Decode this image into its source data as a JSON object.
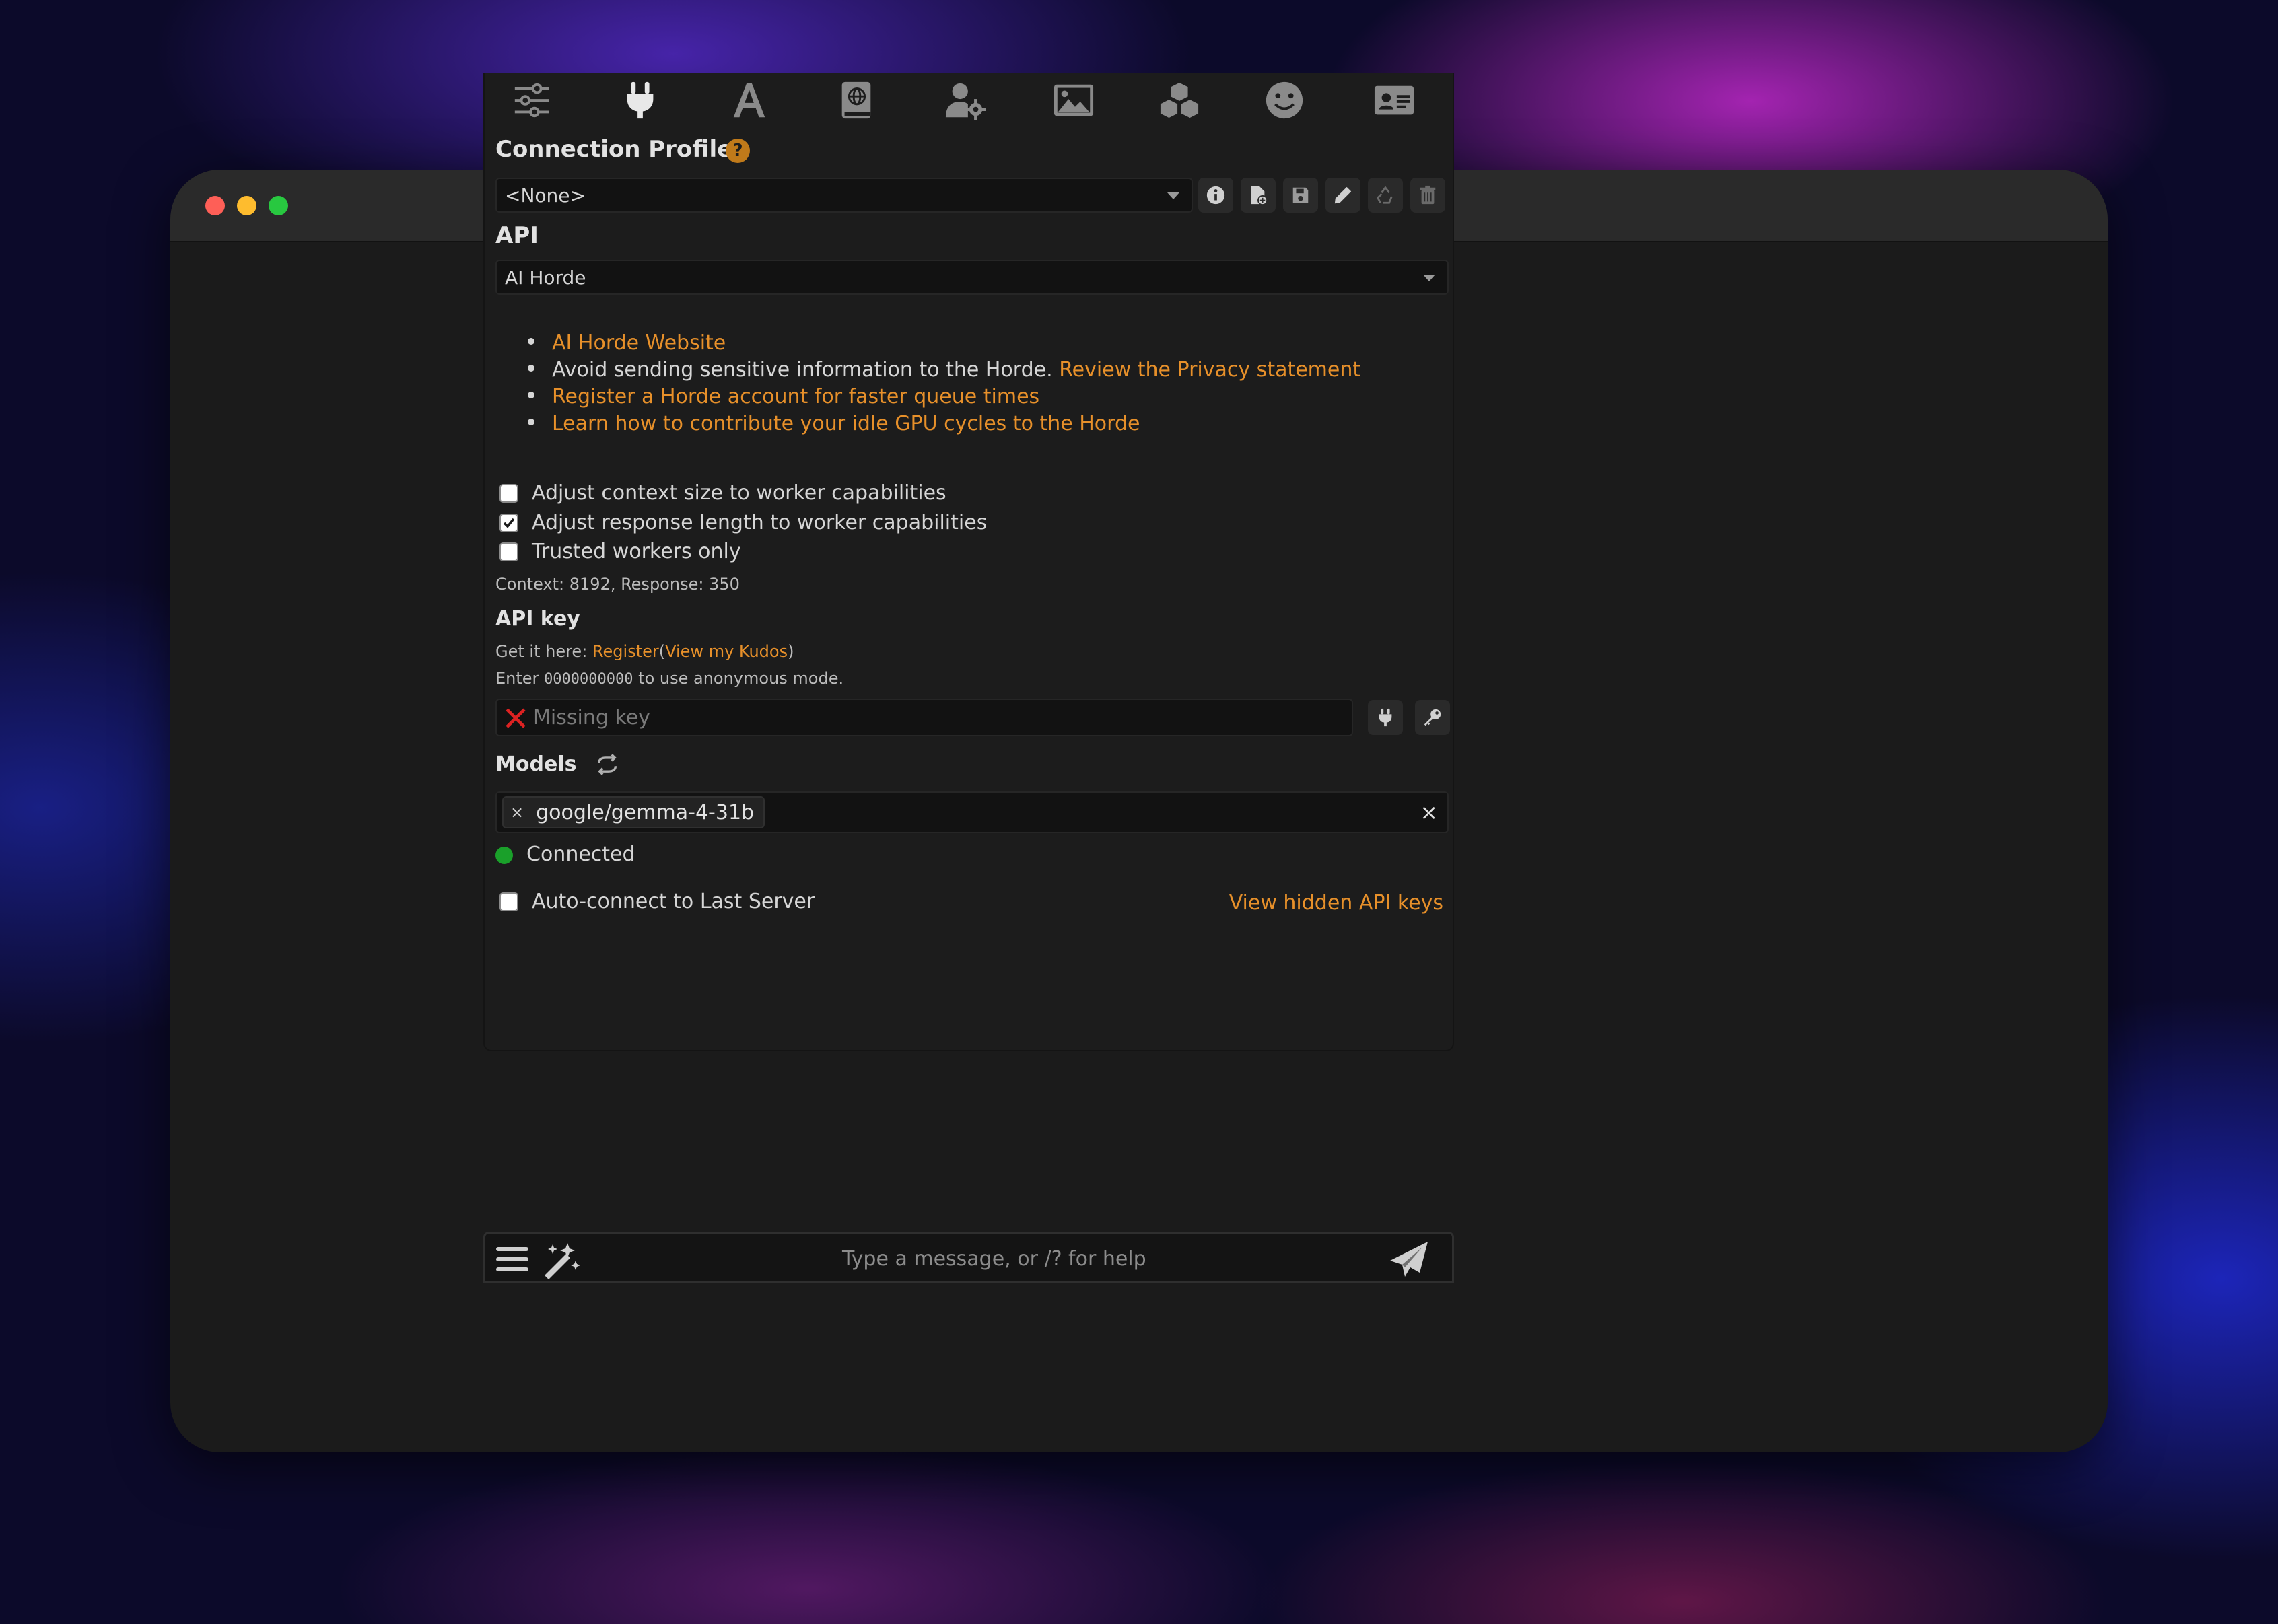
{
  "window": {
    "traffic_lights": [
      "close",
      "minimize",
      "zoom"
    ]
  },
  "topbar": {
    "icons": [
      "sliders-icon",
      "plug-icon",
      "font-icon",
      "book-icon",
      "user-gear-icon",
      "image-icon",
      "cubes-icon",
      "smile-icon",
      "id-card-icon"
    ],
    "active": "plug-icon"
  },
  "connection_profile": {
    "title": "Connection Profile",
    "help": "?",
    "selected": "<None>",
    "buttons": [
      "info-icon",
      "file-plus-icon",
      "save-icon",
      "pencil-icon",
      "recycle-icon",
      "trash-icon"
    ]
  },
  "api": {
    "title": "API",
    "selected": "AI Horde"
  },
  "info_list": {
    "item1_link": "AI Horde Website",
    "item2_text": "Avoid sending sensitive information to the Horde.",
    "item2_link": "Review the Privacy statement",
    "item3_link": "Register a Horde account for faster queue times",
    "item4_link": "Learn how to contribute your idle GPU cycles to the Horde"
  },
  "options": {
    "adjust_context": {
      "label": "Adjust context size to worker capabilities",
      "checked": false
    },
    "adjust_response": {
      "label": "Adjust response length to worker capabilities",
      "checked": true
    },
    "trusted_workers": {
      "label": "Trusted workers only",
      "checked": false
    },
    "context_info": "Context: 8192, Response: 350"
  },
  "api_key": {
    "title": "API key",
    "get_it_prefix": "Get it here:",
    "register_link": "Register",
    "paren_open": "(",
    "kudos_link": "View my Kudos",
    "paren_close": ")",
    "enter_prefix": "Enter",
    "anon_code": "0000000000",
    "enter_suffix": "to use anonymous mode.",
    "placeholder": "Missing key"
  },
  "models": {
    "title": "Models",
    "selected_tag": "google/gemma-4-31b",
    "tag_remove": "×",
    "clear_all": "×",
    "status": "Connected",
    "status_color": "#1aa02a"
  },
  "footer_row": {
    "auto_connect": {
      "label": "Auto-connect to Last Server",
      "checked": false
    },
    "hidden_keys_link": "View hidden API keys"
  },
  "chat": {
    "placeholder": "Type a message, or /? for help"
  },
  "colors": {
    "accent": "#e7902a",
    "panel_bg": "#1c1c1c",
    "window_bg": "#1b1b1b"
  }
}
